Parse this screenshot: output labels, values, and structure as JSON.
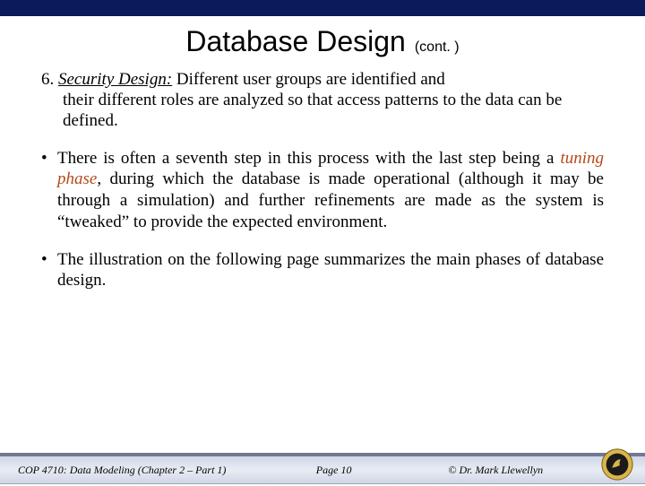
{
  "title": {
    "main": "Database Design",
    "cont": "(cont. )"
  },
  "item6": {
    "number": "6.",
    "label": "Security Design:",
    "rest_first": "   Different user groups are identified and",
    "rest_lines": "their different roles are analyzed so that access patterns to the data can be defined."
  },
  "bullets": [
    {
      "pre": "There is often a seventh step in this process with the last step being a ",
      "tuning": "tuning phase",
      "post": ", during which the database is made operational (although it may be through a simulation) and further refinements are made as the system is “tweaked” to provide the expected environment."
    },
    {
      "pre": "The illustration on the following page summarizes the main phases of database design.",
      "tuning": "",
      "post": ""
    }
  ],
  "footer": {
    "left": "COP 4710: Data Modeling (Chapter 2 – Part 1)",
    "mid": "Page 10",
    "right": "© Dr. Mark Llewellyn"
  }
}
